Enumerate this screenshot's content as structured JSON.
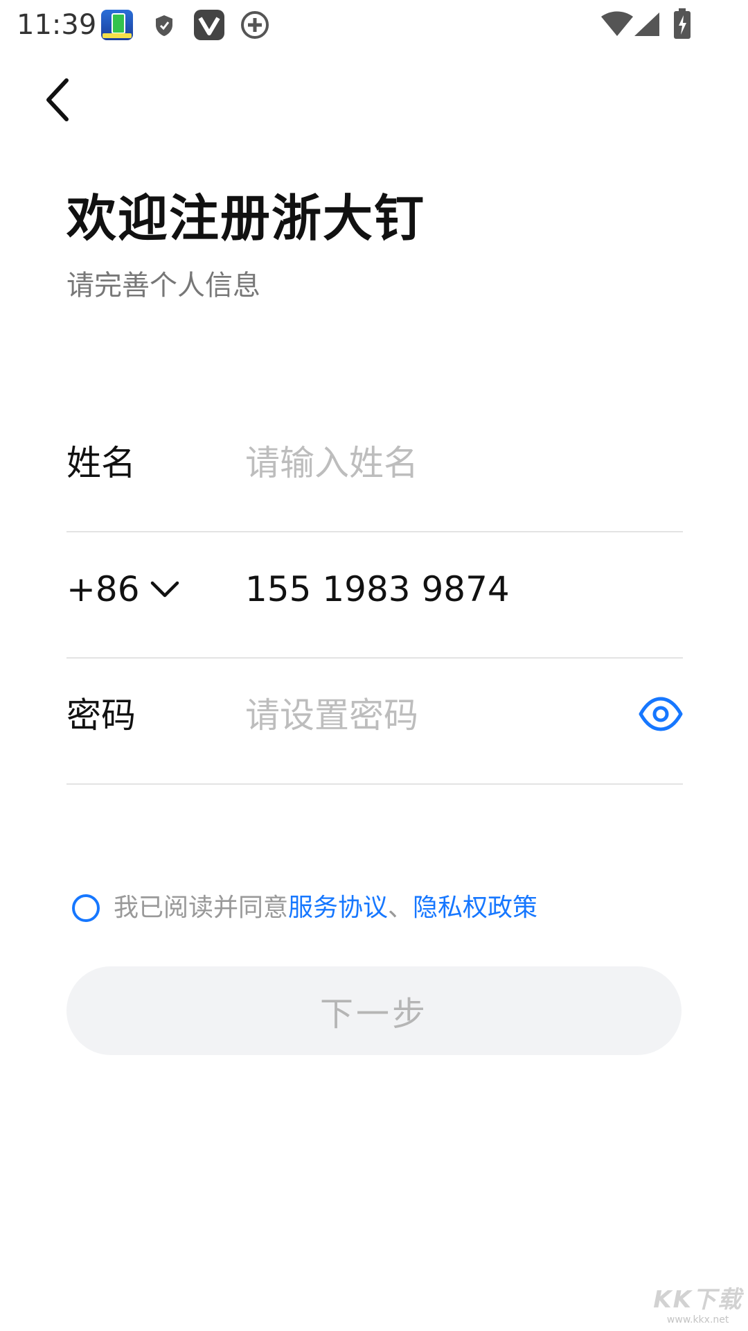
{
  "status_bar": {
    "time": "11:39"
  },
  "header": {
    "title": "欢迎注册浙大钉",
    "subtitle": "请完善个人信息"
  },
  "form": {
    "name": {
      "label": "姓名",
      "placeholder": "请输入姓名",
      "value": ""
    },
    "phone": {
      "country_code": "+86",
      "value": "155 1983 9874"
    },
    "password": {
      "label": "密码",
      "placeholder": "请设置密码",
      "value": ""
    }
  },
  "agreement": {
    "prefix": "我已阅读并同意",
    "service_link": "服务协议",
    "separator": "、",
    "privacy_link": "隐私权政策",
    "checked": false
  },
  "next_button": {
    "label": "下一步"
  },
  "watermark": {
    "logo": "KK下载",
    "url": "www.kkx.net"
  },
  "colors": {
    "accent": "#1677ff",
    "title": "#111111",
    "placeholder": "#bdbdbd",
    "disabled_button_bg": "#f2f3f5",
    "disabled_button_text": "#b5b5b5",
    "divider": "#e3e3e3"
  },
  "icons": {
    "back": "chevron-left-icon",
    "country_dropdown": "chevron-down-icon",
    "password_visibility": "eye-icon",
    "agree_checkbox": "radio-circle-icon"
  }
}
